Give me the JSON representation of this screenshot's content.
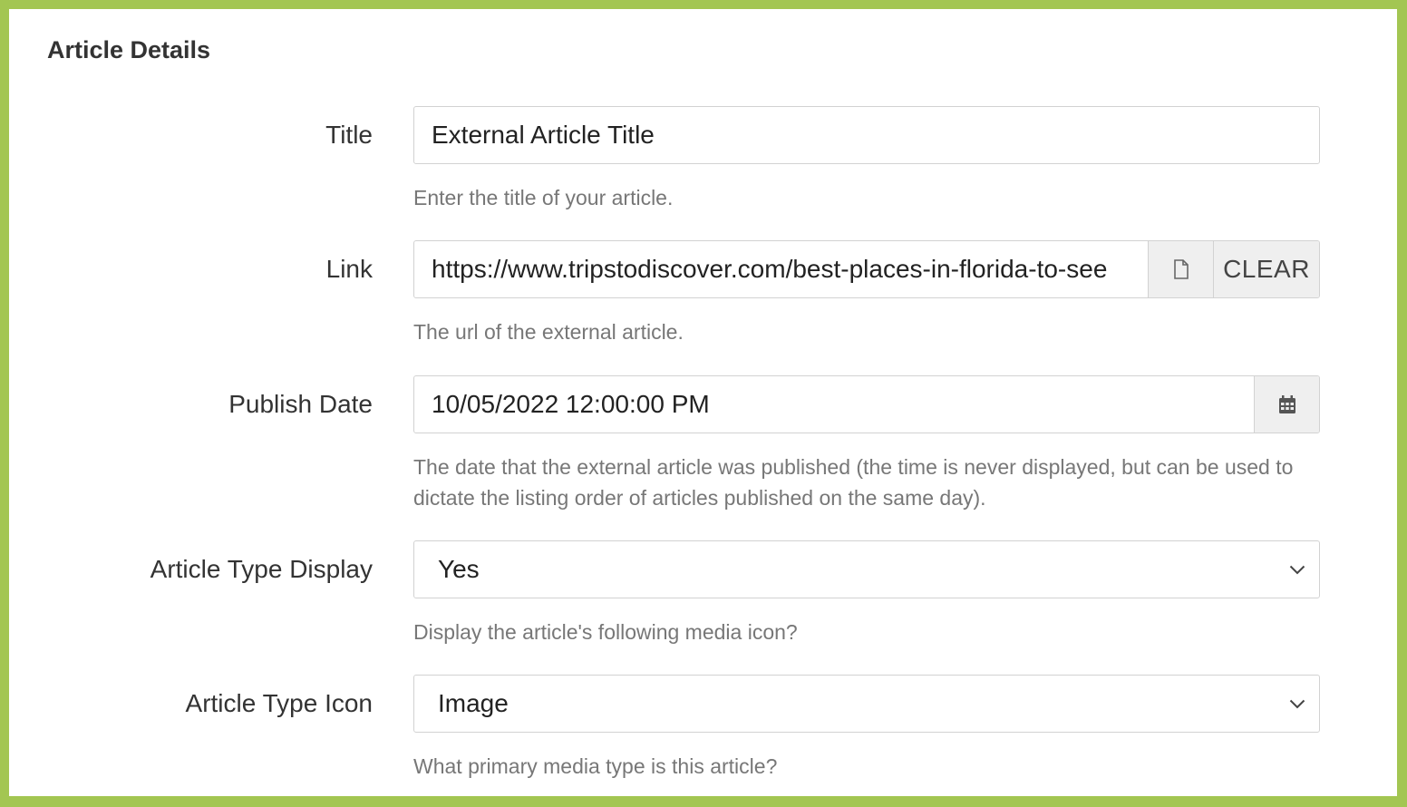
{
  "section": {
    "title": "Article Details"
  },
  "fields": {
    "title": {
      "label": "Title",
      "value": "External Article Title",
      "help": "Enter the title of your article."
    },
    "link": {
      "label": "Link",
      "value": "https://www.tripstodiscover.com/best-places-in-florida-to-see",
      "clear_label": "CLEAR",
      "help": "The url of the external article."
    },
    "publish_date": {
      "label": "Publish Date",
      "value": "10/05/2022 12:00:00 PM",
      "help": "The date that the external article was published (the time is never displayed, but can be used to dictate the listing order of articles published on the same day)."
    },
    "article_type_display": {
      "label": "Article Type Display",
      "selected": "Yes",
      "help": "Display the article's following media icon?"
    },
    "article_type_icon": {
      "label": "Article Type Icon",
      "selected": "Image",
      "help": "What primary media type is this article?"
    }
  },
  "colors": {
    "frame": "#a3c652",
    "border": "#d2d2d2",
    "addon_bg": "#efefef",
    "help_text": "#777777"
  },
  "icons": {
    "file": "file-icon",
    "calendar": "calendar-icon",
    "chevron": "chevron-down-icon"
  }
}
